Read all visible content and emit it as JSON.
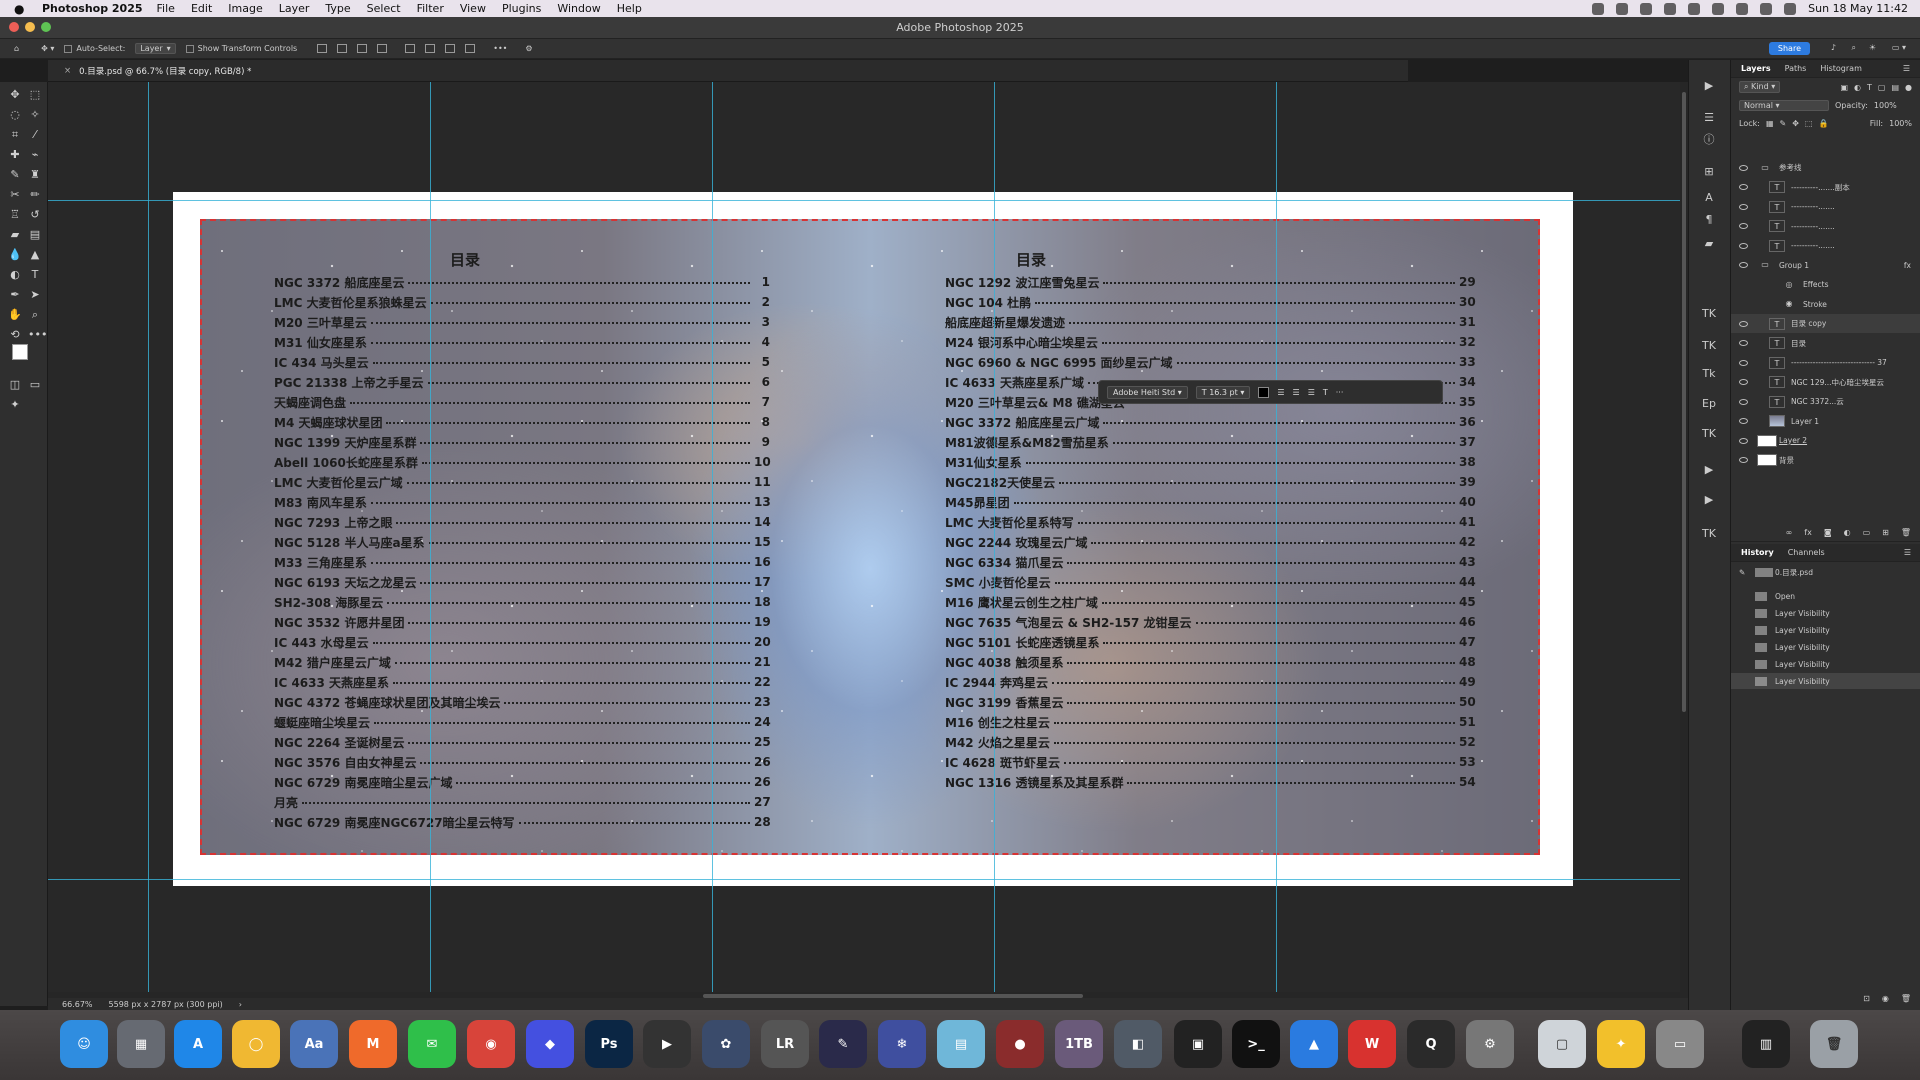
{
  "menubar": {
    "app": "Photoshop 2025",
    "items": [
      "File",
      "Edit",
      "Image",
      "Layer",
      "Type",
      "Select",
      "Filter",
      "View",
      "Plugins",
      "Window",
      "Help"
    ],
    "datetime": "Sun 18 May  11:42"
  },
  "window": {
    "title": "Adobe Photoshop 2025"
  },
  "options": {
    "auto_select": "Auto-Select:",
    "auto_select_target": "Layer",
    "show_transform": "Show Transform Controls",
    "share": "Share"
  },
  "doc_tab": "0.目录.psd @ 66.7% (目录 copy, RGB/8) *",
  "status": {
    "zoom": "66.67%",
    "doc_info": "5598 px x 2787 px (300 ppi)"
  },
  "toc": {
    "left_title": "目录",
    "right_title": "目录",
    "left": [
      {
        "t": "NGC 3372 船底座星云",
        "n": "1"
      },
      {
        "t": "LMC 大麦哲伦星系狼蛛星云",
        "n": "2"
      },
      {
        "t": "M20 三叶草星云",
        "n": "3"
      },
      {
        "t": "M31 仙女座星系",
        "n": "4"
      },
      {
        "t": "IC 434 马头星云",
        "n": "5"
      },
      {
        "t": "PGC 21338 上帝之手星云",
        "n": "6"
      },
      {
        "t": "天蝎座调色盘",
        "n": "7"
      },
      {
        "t": "M4 天蝎座球状星团",
        "n": "8"
      },
      {
        "t": "NGC 1399 天炉座星系群",
        "n": "9"
      },
      {
        "t": "Abell 1060长蛇座星系群",
        "n": "10"
      },
      {
        "t": "LMC 大麦哲伦星云广域",
        "n": "11"
      },
      {
        "t": "M83 南风车星系",
        "n": "13"
      },
      {
        "t": "NGC 7293 上帝之眼",
        "n": "14"
      },
      {
        "t": "NGC 5128 半人马座a星系",
        "n": "15"
      },
      {
        "t": "M33 三角座星系",
        "n": "16"
      },
      {
        "t": "NGC 6193 天坛之龙星云",
        "n": "17"
      },
      {
        "t": "SH2-308 海豚星云",
        "n": "18"
      },
      {
        "t": "NGC 3532 许愿井星团",
        "n": "19"
      },
      {
        "t": "IC 443 水母星云",
        "n": "20"
      },
      {
        "t": "M42 猎户座星云广域",
        "n": "21"
      },
      {
        "t": "IC 4633 天燕座星系",
        "n": "22"
      },
      {
        "t": "NGC 4372 苍蝇座球状星团及其暗尘埃云",
        "n": "23"
      },
      {
        "t": "蝘蜓座暗尘埃星云",
        "n": "24"
      },
      {
        "t": "NGC 2264 圣诞树星云",
        "n": "25"
      },
      {
        "t": "NGC 3576 自由女神星云",
        "n": "26"
      },
      {
        "t": "NGC 6729 南冕座暗尘星云广域",
        "n": "26"
      },
      {
        "t": "月亮",
        "n": "27"
      },
      {
        "t": "NGC 6729 南冕座NGC6727暗尘星云特写",
        "n": "28"
      }
    ],
    "right": [
      {
        "t": "NGC 1292 波江座雪兔星云",
        "n": "29"
      },
      {
        "t": "NGC 104 杜鹃",
        "n": "30"
      },
      {
        "t": "船底座超新星爆发遗迹",
        "n": "31"
      },
      {
        "t": "M24 银河系中心暗尘埃星云",
        "n": "32"
      },
      {
        "t": "NGC 6960 & NGC 6995 面纱星云广域",
        "n": "33"
      },
      {
        "t": "IC 4633 天燕座星系广域",
        "n": "34"
      },
      {
        "t": "M20 三叶草星云& M8 礁湖星云",
        "n": "35"
      },
      {
        "t": "NGC 3372 船底座星云广域",
        "n": "36"
      },
      {
        "t": "M81波德星系&M82雪茄星系",
        "n": "37"
      },
      {
        "t": "M31仙女星系",
        "n": "38"
      },
      {
        "t": "NGC2182天使星云",
        "n": "39"
      },
      {
        "t": "M45昴星团",
        "n": "40"
      },
      {
        "t": "LMC 大麦哲伦星系特写",
        "n": "41"
      },
      {
        "t": "NGC 2244 玫瑰星云广域",
        "n": "42"
      },
      {
        "t": "NGC 6334 猫爪星云",
        "n": "43"
      },
      {
        "t": "SMC 小麦哲伦星云",
        "n": "44"
      },
      {
        "t": "M16 鹰状星云创生之柱广域",
        "n": "45"
      },
      {
        "t": "NGC 7635 气泡星云 & SH2-157 龙钳星云",
        "n": "46"
      },
      {
        "t": "NGC 5101 长蛇座透镜星系",
        "n": "47"
      },
      {
        "t": "NGC 4038 触须星系",
        "n": "48"
      },
      {
        "t": "IC 2944 奔鸡星云",
        "n": "49"
      },
      {
        "t": "NGC 3199 香蕉星云",
        "n": "50"
      },
      {
        "t": "M16 创生之柱星云",
        "n": "51"
      },
      {
        "t": "M42 火焰之星星云",
        "n": "52"
      },
      {
        "t": "IC 4628 斑节虾星云",
        "n": "53"
      },
      {
        "t": "NGC 1316 透镜星系及其星系群",
        "n": "54"
      }
    ]
  },
  "ctx_toolbar": {
    "font": "Adobe Heiti Std",
    "size": "16.3 pt",
    "more": "···"
  },
  "layers_panel": {
    "tabs": [
      "Layers",
      "Paths",
      "Histogram"
    ],
    "kind": "Kind",
    "blend": "Normal",
    "opacity_label": "Opacity:",
    "opacity": "100%",
    "lock_label": "Lock:",
    "fill_label": "Fill:",
    "fill": "100%",
    "layers": [
      {
        "name": "参考线",
        "type": "folder"
      },
      {
        "name": "----------.......副本",
        "type": "text"
      },
      {
        "name": "----------.......",
        "type": "text"
      },
      {
        "name": "----------.......",
        "type": "text"
      },
      {
        "name": "----------.......",
        "type": "text"
      },
      {
        "name": "Group 1",
        "type": "folder",
        "fx": "fx"
      },
      {
        "name": "Effects",
        "type": "effects"
      },
      {
        "name": "Stroke",
        "type": "effect"
      },
      {
        "name": "目录 copy",
        "type": "text",
        "selected": true
      },
      {
        "name": "目录",
        "type": "text"
      },
      {
        "name": "------------------------------- 37",
        "type": "text"
      },
      {
        "name": "NGC 129...中心暗尘埃星云",
        "type": "text"
      },
      {
        "name": "NGC 3372...云",
        "type": "text"
      },
      {
        "name": "Layer 1",
        "type": "image"
      },
      {
        "name": "Layer 2",
        "type": "white"
      },
      {
        "name": "背景",
        "type": "white"
      }
    ]
  },
  "history_panel": {
    "tabs": [
      "History",
      "Channels"
    ],
    "snapshot": "0.目录.psd",
    "items": [
      "Open",
      "Layer Visibility",
      "Layer Visibility",
      "Layer Visibility",
      "Layer Visibility",
      "Layer Visibility"
    ]
  },
  "dock": {
    "items": [
      {
        "name": "finder",
        "label": "☺",
        "color": "#2f8de0"
      },
      {
        "name": "launchpad",
        "label": "▦",
        "color": "#666a72"
      },
      {
        "name": "app-store",
        "label": "A",
        "color": "#1f87e8"
      },
      {
        "name": "notes-app",
        "label": "◯",
        "color": "#f0b832"
      },
      {
        "name": "dictionary",
        "label": "Aa",
        "color": "#4a73b8"
      },
      {
        "name": "mweb",
        "label": "M",
        "color": "#ef6a2b"
      },
      {
        "name": "wechat",
        "label": "✉",
        "color": "#2fbf4a"
      },
      {
        "name": "chrome",
        "label": "◉",
        "color": "#d8443a"
      },
      {
        "name": "gem-app",
        "label": "◆",
        "color": "#4450e0"
      },
      {
        "name": "photoshop",
        "label": "Ps",
        "color": "#0b2644"
      },
      {
        "name": "final-cut",
        "label": "▶",
        "color": "#333"
      },
      {
        "name": "davinci",
        "label": "✿",
        "color": "#3a4b6b"
      },
      {
        "name": "lrtimelapse",
        "label": "LR",
        "color": "#555"
      },
      {
        "name": "pixelmator",
        "label": "✎",
        "color": "#2a2a4a"
      },
      {
        "name": "snow-app",
        "label": "❄",
        "color": "#3f4f9f"
      },
      {
        "name": "files-app",
        "label": "▤",
        "color": "#6fb7d9"
      },
      {
        "name": "starry-app",
        "label": "●",
        "color": "#8a2c2c"
      },
      {
        "name": "baidu-disk",
        "label": "1TB",
        "color": "#6a5a7a"
      },
      {
        "name": "camera-app",
        "label": "◧",
        "color": "#505a66"
      },
      {
        "name": "screen-app",
        "label": "▣",
        "color": "#222"
      },
      {
        "name": "terminal",
        "label": ">_",
        "color": "#111"
      },
      {
        "name": "cloud-app",
        "label": "▲",
        "color": "#2a7be0"
      },
      {
        "name": "wps",
        "label": "W",
        "color": "#d8322f"
      },
      {
        "name": "quicktime",
        "label": "Q",
        "color": "#2a2a2a"
      },
      {
        "name": "system-settings",
        "label": "⚙",
        "color": "#777"
      },
      {
        "name": "preview-app",
        "label": "▢",
        "color": "#cfd4d9"
      },
      {
        "name": "tips-app",
        "label": "✦",
        "color": "#f2c02b"
      },
      {
        "name": "remote-app",
        "label": "▭",
        "color": "#888"
      },
      {
        "name": "document-thumb",
        "label": "▥",
        "color": "#222"
      },
      {
        "name": "trash",
        "label": "🗑",
        "color": "#9aa0a6"
      }
    ]
  },
  "colors": {
    "accent": "#2d7be0",
    "guide": "#37b3d8",
    "stroke": "#d73333"
  }
}
